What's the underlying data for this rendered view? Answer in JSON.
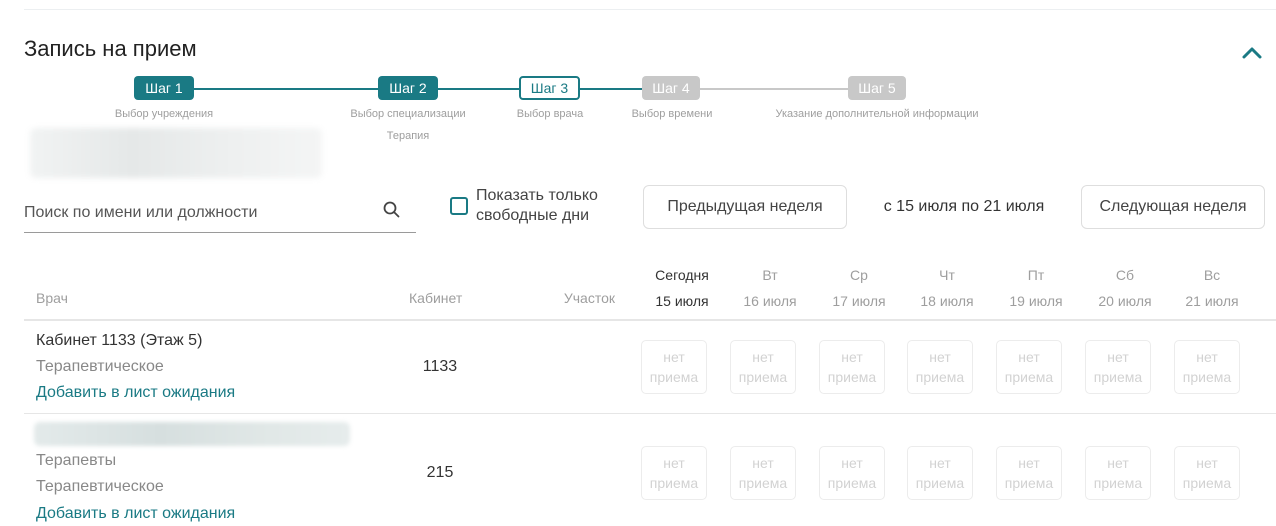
{
  "page": {
    "title": "Запись на прием"
  },
  "steps": [
    {
      "label": "Шаг 1",
      "caption": "Выбор учреждения",
      "state": "done"
    },
    {
      "label": "Шаг 2",
      "caption": "Выбор специализации",
      "sub": "Терапия",
      "state": "done"
    },
    {
      "label": "Шаг 3",
      "caption": "Выбор врача",
      "state": "current"
    },
    {
      "label": "Шаг 4",
      "caption": "Выбор времени",
      "state": "future"
    },
    {
      "label": "Шаг 5",
      "caption": "Указание дополнительной информации",
      "state": "future"
    }
  ],
  "search": {
    "placeholder": "Поиск по имени или должности",
    "value": ""
  },
  "free_days": {
    "label": "Показать только свободные дни",
    "checked": false
  },
  "week_nav": {
    "prev_label": "Предыдущая неделя",
    "range": "с 15 июля по 21 июля",
    "next_label": "Следующая неделя"
  },
  "table": {
    "headers": {
      "doctor": "Врач",
      "cabinet": "Кабинет",
      "district": "Участок"
    },
    "days": [
      {
        "name": "Сегодня",
        "date": "15 июля",
        "today": true
      },
      {
        "name": "Вт",
        "date": "16 июля"
      },
      {
        "name": "Ср",
        "date": "17 июля"
      },
      {
        "name": "Чт",
        "date": "18 июля"
      },
      {
        "name": "Пт",
        "date": "19 июля"
      },
      {
        "name": "Сб",
        "date": "20 июля"
      },
      {
        "name": "Вс",
        "date": "21 июля"
      }
    ],
    "slot_text": "нет\nприема",
    "rows": [
      {
        "name": "Кабинет 1133 (Этаж 5)",
        "specialty": "Терапевтическое",
        "cabinet": "1133",
        "district": "",
        "waitlist": "Добавить в лист ожидания"
      },
      {
        "name": "",
        "position": "Терапевты",
        "specialty": "Терапевтическое",
        "cabinet": "215",
        "district": "",
        "waitlist": "Добавить в лист ожидания"
      }
    ]
  },
  "colors": {
    "accent": "#1a7a84",
    "inactive_step": "#c8c8c8",
    "muted_text": "#9e9e9e",
    "disabled_slot_text": "#d2d2d2"
  },
  "icons": {
    "collapse": "chevron-up-icon",
    "search": "search-icon"
  }
}
